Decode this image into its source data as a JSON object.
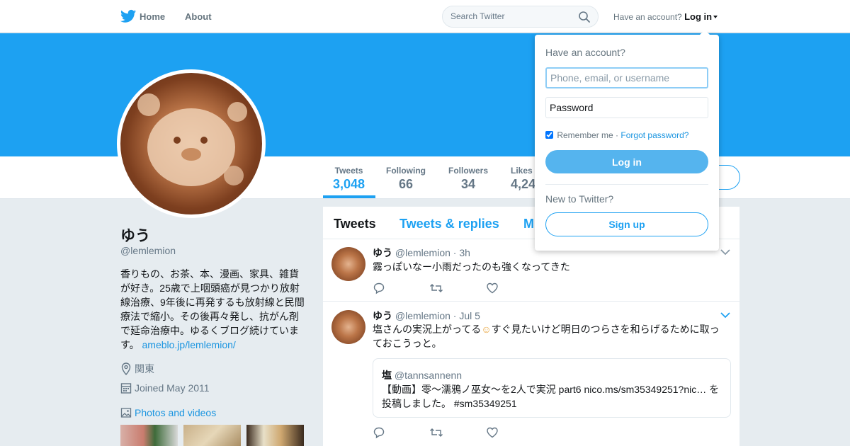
{
  "nav": {
    "home_label": "Home",
    "about_label": "About",
    "search_placeholder": "Search Twitter",
    "have_account_text": "Have an account?",
    "login_label": "Log in"
  },
  "profile": {
    "name": "ゆう",
    "handle": "@lemlemion",
    "bio": "香りもの、お茶、本、漫画、家具、雑貨が好き。25歳で上咽頭癌が見つかり放射線治療、9年後に再発するも放射線と民間療法で縮小。その後再々発し、抗がん剤で延命治療中。ゆるくブログ続けています。",
    "bio_link": "ameblo.jp/lemlemion/",
    "location": "関東",
    "joined": "Joined May 2011",
    "photos_label": "Photos and videos"
  },
  "stats": [
    {
      "label": "Tweets",
      "value": "3,048"
    },
    {
      "label": "Following",
      "value": "66"
    },
    {
      "label": "Followers",
      "value": "34"
    },
    {
      "label": "Likes",
      "value": "4,24"
    }
  ],
  "timeline": {
    "tabs": [
      "Tweets",
      "Tweets & replies",
      "M"
    ],
    "tweets": [
      {
        "name": "ゆう",
        "handle": "@lemlemion",
        "time": "· 3h",
        "text": "霧っぽいなー小雨だったのも強くなってきた"
      },
      {
        "name": "ゆう",
        "handle": "@lemlemion",
        "time": "· Jul 5",
        "text_a": "塩さんの実況上がってる",
        "emoji": "☺",
        "text_b": "すぐ見たいけど明日のつらさを和らげるために取っておこうっと。",
        "quote": {
          "name": "塩",
          "handle": "@tannsannenn",
          "text": "【動画】零～濡鴉ノ巫女～を2人で実況 part6 nico.ms/sm35349251?nic… を投稿しました。 #sm35349251"
        }
      }
    ]
  },
  "login_dropdown": {
    "title": "Have an account?",
    "username_placeholder": "Phone, email, or username",
    "password_placeholder": "Password",
    "remember_label": "Remember me",
    "separator": "·",
    "forgot_label": "Forgot password?",
    "login_button": "Log in",
    "new_text": "New to Twitter?",
    "signup_button": "Sign up"
  },
  "colors": {
    "accent": "#1da1f2",
    "banner": "#1da1f2",
    "background": "#e6ecf0"
  }
}
